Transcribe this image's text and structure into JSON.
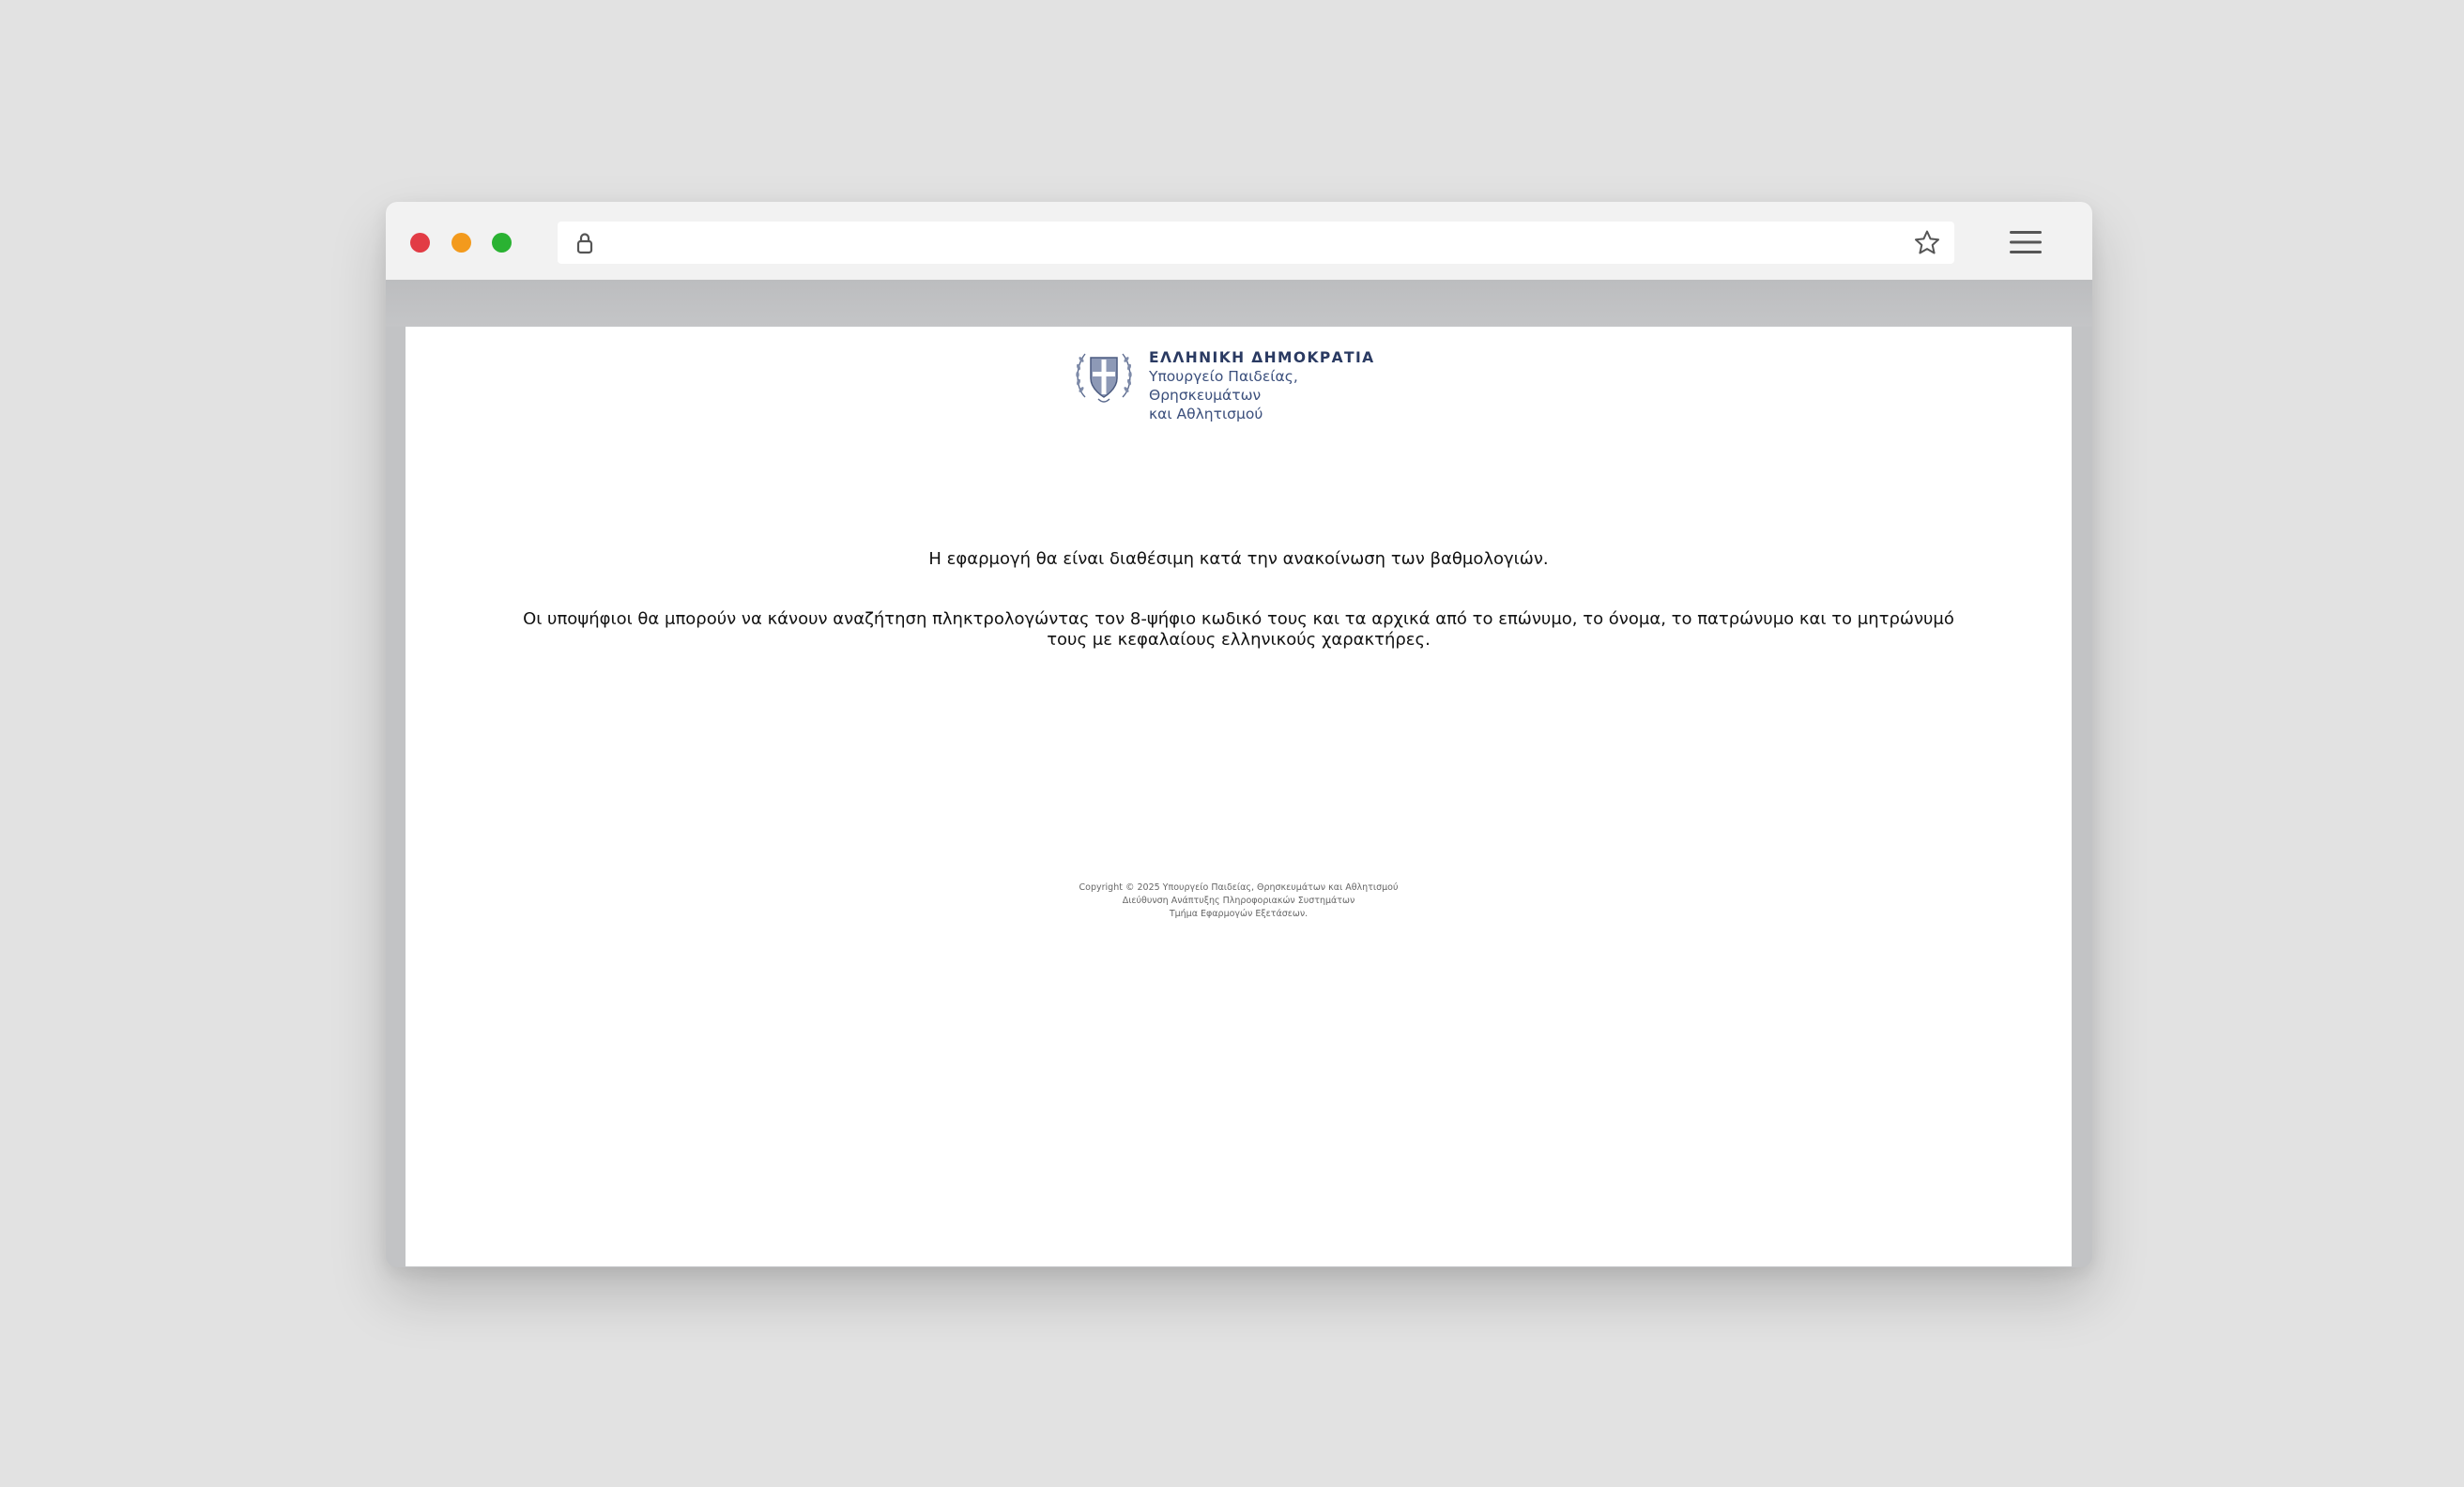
{
  "browser": {
    "url": "",
    "icons": {
      "lock": "lock-icon",
      "bookmark": "star-icon",
      "menu": "hamburger-menu-icon"
    },
    "traffic_lights": {
      "close": "#e23c45",
      "minimize": "#f39a1d",
      "maximize": "#2ab232"
    }
  },
  "header": {
    "emblem": "greek-coat-of-arms-icon",
    "line1": "ΕΛΛΗΝΙΚΗ ΔΗΜΟΚΡΑΤΙΑ",
    "line2": "Υπουργείο Παιδείας, Θρησκευμάτων",
    "line3": "και Αθλητισμού"
  },
  "main": {
    "message": "Η εφαρμογή θα είναι διαθέσιμη κατά την ανακοίνωση των βαθμολογιών.",
    "instructions": "Οι υποψήφιοι θα μπορούν να κάνουν αναζήτηση πληκτρολογώντας τον 8-ψήφιο κωδικό τους και τα αρχικά από το επώνυμο, το όνομα, το πατρώνυμο και το μητρώνυμό τους με κεφαλαίους ελληνικούς χαρακτήρες."
  },
  "footer": {
    "line1": "Copyright © 2025 Υπουργείο Παιδείας, Θρησκευμάτων και Αθλητισμού",
    "line2": "Διεύθυνση Ανάπτυξης Πληροφοριακών Συστημάτων",
    "line3": "Τμήμα Εφαρμογών Εξετάσεων."
  }
}
